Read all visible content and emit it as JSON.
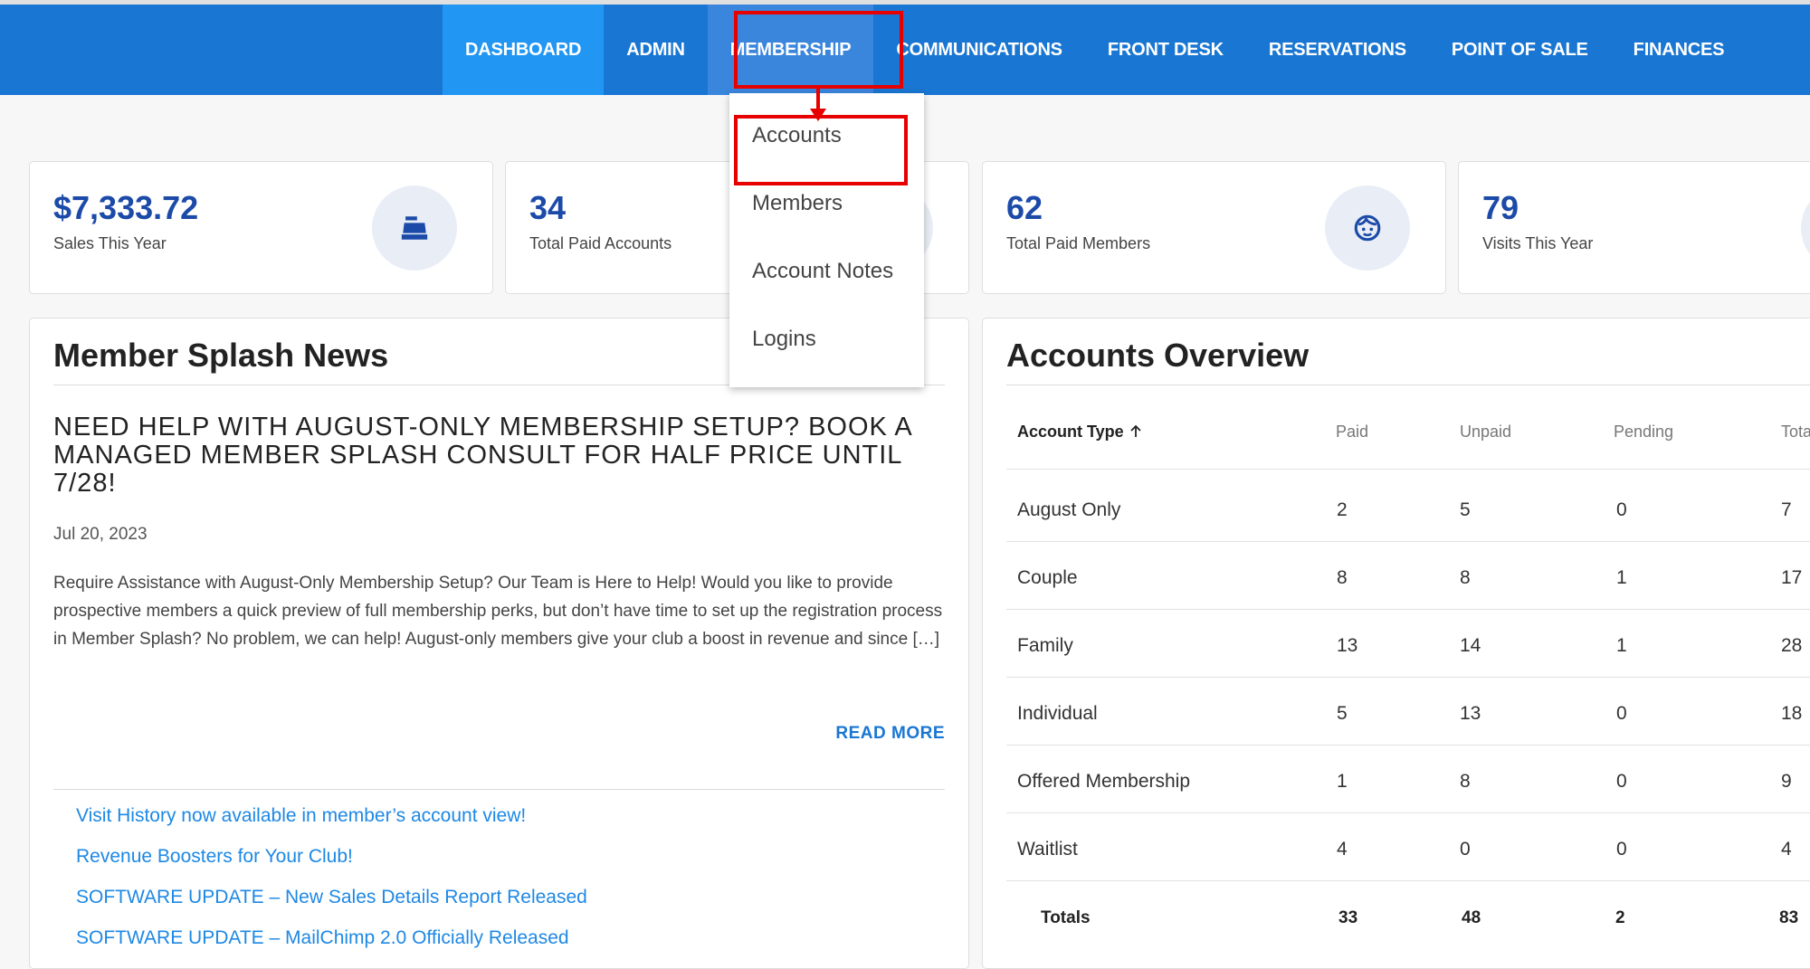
{
  "nav": {
    "items": [
      "DASHBOARD",
      "ADMIN",
      "MEMBERSHIP",
      "COMMUNICATIONS",
      "FRONT DESK",
      "RESERVATIONS",
      "POINT OF SALE",
      "FINANCES"
    ]
  },
  "membership_menu": {
    "items": [
      "Accounts",
      "Members",
      "Account Notes",
      "Logins"
    ]
  },
  "stats": [
    {
      "value": "$7,333.72",
      "label": "Sales This Year",
      "icon": "cash-register-icon"
    },
    {
      "value": "34",
      "label": "Total Paid Accounts",
      "icon": "accounts-icon"
    },
    {
      "value": "62",
      "label": "Total Paid Members",
      "icon": "member-face-icon"
    },
    {
      "value": "79",
      "label": "Visits This Year",
      "icon": "visits-icon"
    }
  ],
  "news": {
    "title": "Member Splash News",
    "headline": "NEED HELP WITH AUGUST-ONLY MEMBERSHIP SETUP? BOOK A MANAGED MEMBER SPLASH CONSULT FOR HALF PRICE UNTIL 7/28!",
    "date": "Jul 20, 2023",
    "excerpt": "Require Assistance with August-Only Membership Setup? Our Team is Here to Help! Would you like to provide prospective members a quick preview of full membership perks, but don’t have time to set up the registration process in Member Splash? No problem, we can help! August-only members give your club a boost in revenue and since […]",
    "read_more": "READ MORE",
    "links": [
      "Visit History now available in member’s account view!",
      "Revenue Boosters for Your Club!",
      "SOFTWARE UPDATE – New Sales Details Report Released",
      "SOFTWARE UPDATE – MailChimp 2.0 Officially Released"
    ]
  },
  "overview": {
    "title": "Accounts Overview",
    "columns": [
      "Account Type",
      "Paid",
      "Unpaid",
      "Pending",
      "Total"
    ],
    "rows": [
      [
        "August Only",
        "2",
        "5",
        "0",
        "7"
      ],
      [
        "Couple",
        "8",
        "8",
        "1",
        "17"
      ],
      [
        "Family",
        "13",
        "14",
        "1",
        "28"
      ],
      [
        "Individual",
        "5",
        "13",
        "0",
        "18"
      ],
      [
        "Offered Membership",
        "1",
        "8",
        "0",
        "9"
      ],
      [
        "Waitlist",
        "4",
        "0",
        "0",
        "4"
      ]
    ],
    "totals": [
      "Totals",
      "33",
      "48",
      "2",
      "83"
    ]
  },
  "colors": {
    "nav_bg": "#1976d2",
    "nav_active": "#2196f3",
    "stat_value": "#1b4aa8",
    "link": "#1e88e5",
    "highlight": "#e60000"
  }
}
